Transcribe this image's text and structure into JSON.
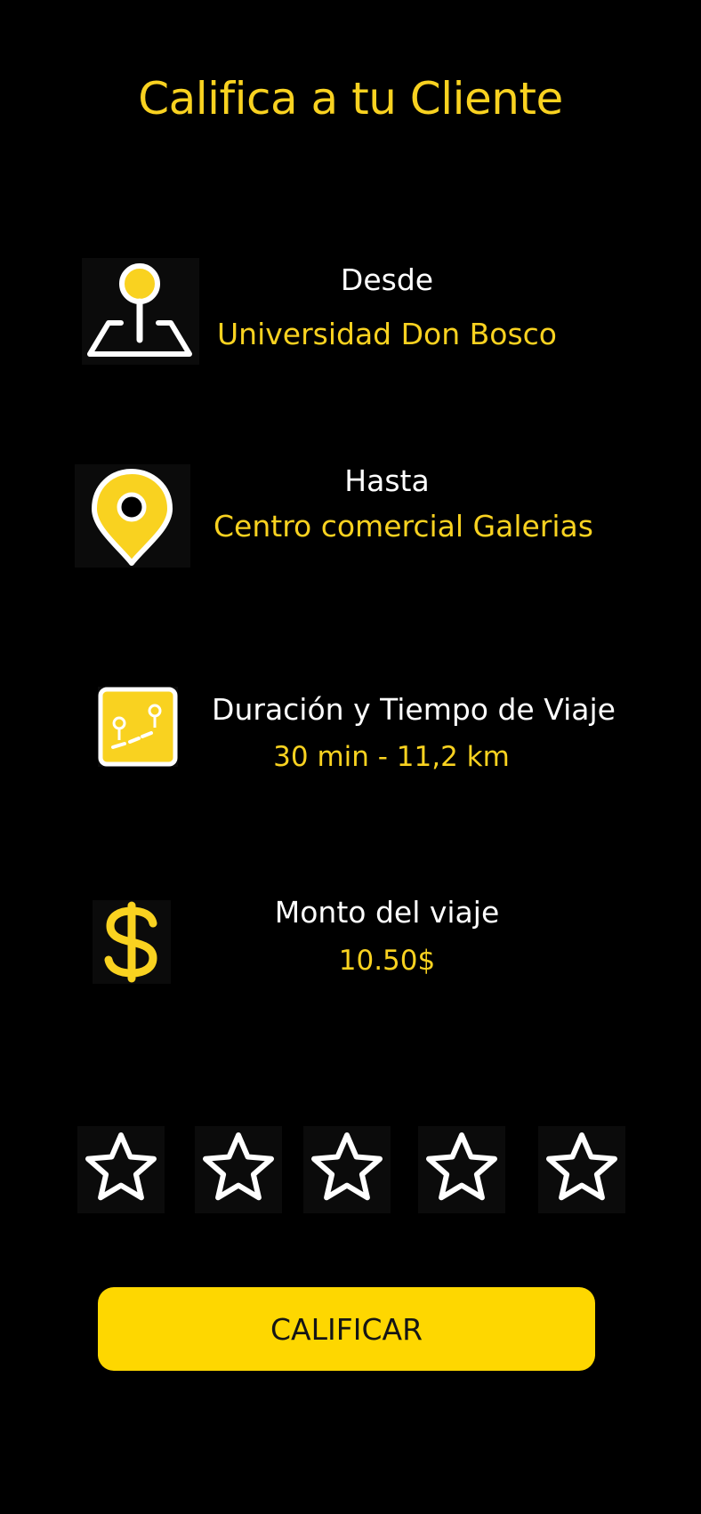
{
  "title": "Califica a tu Cliente",
  "colors": {
    "accent": "#f9d220",
    "button": "#fed700",
    "background": "#000000",
    "text": "#ffffff"
  },
  "trip": {
    "from": {
      "label": "Desde",
      "value": "Universidad Don Bosco",
      "icon": "map-pin-area-icon"
    },
    "to": {
      "label": "Hasta",
      "value": "Centro comercial Galerias",
      "icon": "location-marker-icon"
    },
    "duration": {
      "label": "Duración y Tiempo de Viaje",
      "value": "30 min - 11,2 km",
      "icon": "route-map-icon"
    },
    "amount": {
      "label": "Monto del viaje",
      "value": "10.50$",
      "icon": "dollar-icon"
    }
  },
  "rating": {
    "max": 5,
    "selected": 0
  },
  "button_label": "CALIFICAR"
}
